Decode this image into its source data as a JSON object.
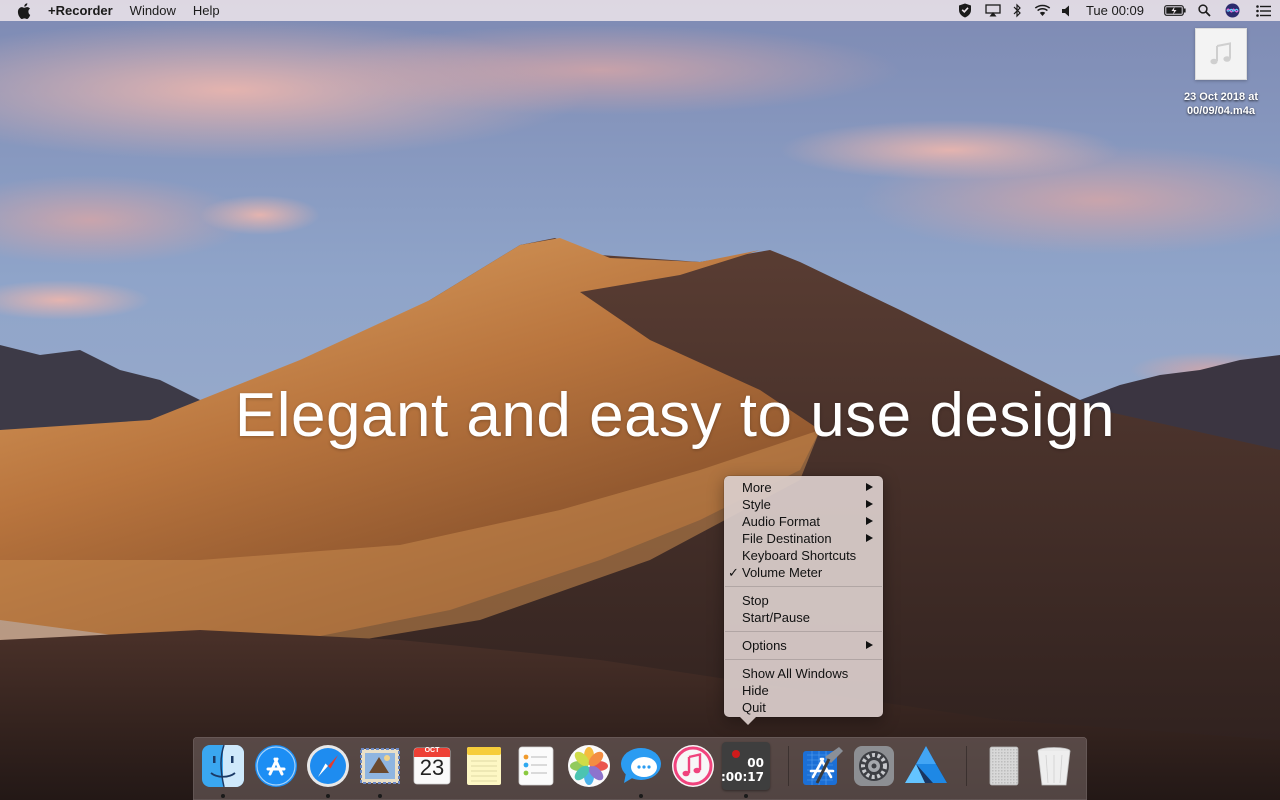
{
  "menubar": {
    "apple_icon": "apple-logo-icon",
    "app_name": "+Recorder",
    "items": [
      "Window",
      "Help"
    ],
    "status_icons": [
      "shield-icon",
      "airplay-icon",
      "bluetooth-icon",
      "wifi-icon",
      "volume-icon"
    ],
    "clock": "Tue 00:09",
    "right_icons": [
      "battery-icon",
      "spotlight-search-icon",
      "siri-icon",
      "notification-center-icon"
    ]
  },
  "desktop_file": {
    "icon": "music-note-icon",
    "name_line1": "23 Oct 2018 at",
    "name_line2": "00/09/04.m4a"
  },
  "headline": "Elegant and easy to use design",
  "context_menu": {
    "items": [
      {
        "label": "More",
        "submenu": true
      },
      {
        "label": "Style",
        "submenu": true
      },
      {
        "label": "Audio Format",
        "submenu": true
      },
      {
        "label": "File Destination",
        "submenu": true
      },
      {
        "label": "Keyboard Shortcuts",
        "submenu": false
      },
      {
        "label": "Volume Meter",
        "checked": true
      },
      {
        "label": "Stop"
      },
      {
        "label": "Start/Pause"
      },
      {
        "label": "Options",
        "submenu": true
      },
      {
        "label": "Show All Windows"
      },
      {
        "label": "Hide"
      },
      {
        "label": "Quit"
      }
    ]
  },
  "dock": {
    "apps": [
      "Finder",
      "App Store",
      "Safari",
      "Mail",
      "Calendar",
      "Notes",
      "Reminders",
      "Photos",
      "Messages",
      "iTunes",
      "Recorder",
      "Xcode",
      "System Preferences",
      "Affinity Designer",
      "Downloads",
      "Trash"
    ],
    "calendar_month": "OCT",
    "calendar_day": "23",
    "recorder_line1": "00",
    "recorder_line2": ":00:17"
  },
  "colors": {
    "menu_bg": "#ece4ea",
    "dock_bg": "#786967",
    "record_red": "#d01b1b"
  }
}
